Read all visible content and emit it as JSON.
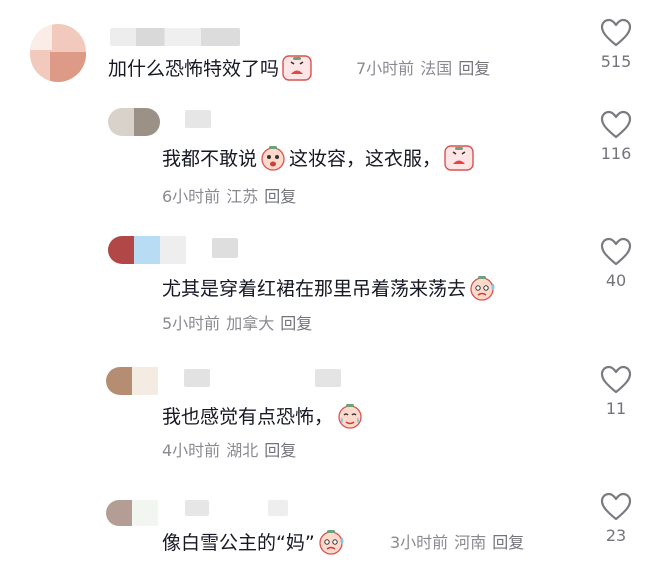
{
  "comments": [
    {
      "text": "加什么恐怖特效了吗",
      "time": "7小时前",
      "location": "法国",
      "reply": "回复",
      "likes": "515",
      "emoji": [
        "crying-face-icon"
      ]
    },
    {
      "text_a": "我都不敢说",
      "text_b": "这妆容，这衣服，",
      "time": "6小时前",
      "location": "江苏",
      "reply": "回复",
      "likes": "116",
      "emoji": [
        "scared-face-icon",
        "crying-face-icon"
      ]
    },
    {
      "text": "尤其是穿着红裙在那里吊着荡来荡去",
      "time": "5小时前",
      "location": "加拿大",
      "reply": "回复",
      "likes": "40",
      "emoji": [
        "sweating-face-icon"
      ]
    },
    {
      "text": "我也感觉有点恐怖，",
      "time": "4小时前",
      "location": "湖北",
      "reply": "回复",
      "likes": "11",
      "emoji": [
        "tearful-face-icon"
      ]
    },
    {
      "text": "像白雪公主的“妈”",
      "time": "3小时前",
      "location": "河南",
      "reply": "回复",
      "likes": "23",
      "emoji": [
        "sweating-face-icon"
      ]
    }
  ],
  "colors": {
    "text": "#161823",
    "meta": "#8a8b91",
    "heart_outline": "#7a7b80"
  }
}
